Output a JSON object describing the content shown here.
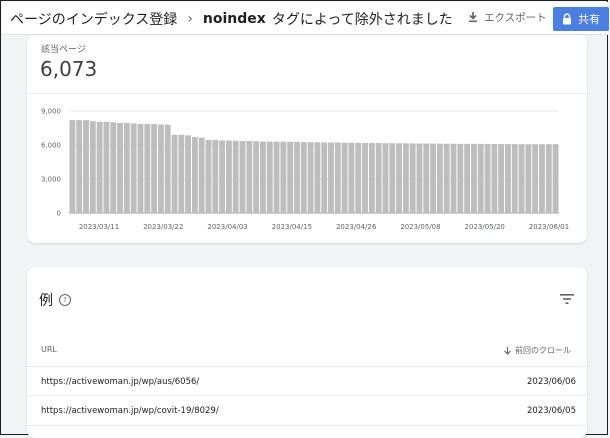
{
  "header": {
    "title_prefix": "ページのインデックス登録",
    "breadcrumb_sep": "›",
    "title_bold": "noindex",
    "title_suffix": "タグによって除外されました",
    "export_label": "エクスポート",
    "share_label": "共有"
  },
  "metric": {
    "label": "該当ページ",
    "value": "6,073"
  },
  "chart_data": {
    "type": "bar",
    "title": "",
    "xlabel": "",
    "ylabel": "",
    "ylim": [
      0,
      9000
    ],
    "yticks": [
      "0",
      "3,000",
      "6,000",
      "9,000"
    ],
    "xtick_labels": [
      "2023/03/11",
      "2023/03/22",
      "2023/04/03",
      "2023/04/15",
      "2023/04/26",
      "2023/05/08",
      "2023/05/20",
      "2023/06/01"
    ],
    "values": [
      8200,
      8200,
      8200,
      8100,
      8050,
      8050,
      8000,
      7950,
      7950,
      7900,
      7850,
      7850,
      7850,
      7800,
      7800,
      6900,
      6900,
      6850,
      6700,
      6650,
      6450,
      6450,
      6400,
      6400,
      6380,
      6350,
      6350,
      6330,
      6300,
      6300,
      6300,
      6290,
      6280,
      6280,
      6260,
      6250,
      6250,
      6230,
      6220,
      6220,
      6200,
      6200,
      6190,
      6180,
      6180,
      6170,
      6160,
      6160,
      6150,
      6150,
      6140,
      6130,
      6130,
      6120,
      6120,
      6110,
      6110,
      6100,
      6100,
      6100,
      6100,
      6090,
      6090,
      6080,
      6080,
      6080,
      6070,
      6070,
      6070,
      6070,
      6073,
      6073
    ]
  },
  "examples": {
    "title": "例",
    "help_icon_text": "?",
    "col_url": "URL",
    "col_crawl": "前回のクロール",
    "rows": [
      {
        "url": "https://activewoman.jp/wp/aus/6056/",
        "date": "2023/06/06"
      },
      {
        "url": "https://activewoman.jp/wp/covit-19/8029/",
        "date": "2023/06/05"
      }
    ]
  },
  "colors": {
    "bar": "#bdbdbd",
    "share_button": "#4a7ee0"
  }
}
